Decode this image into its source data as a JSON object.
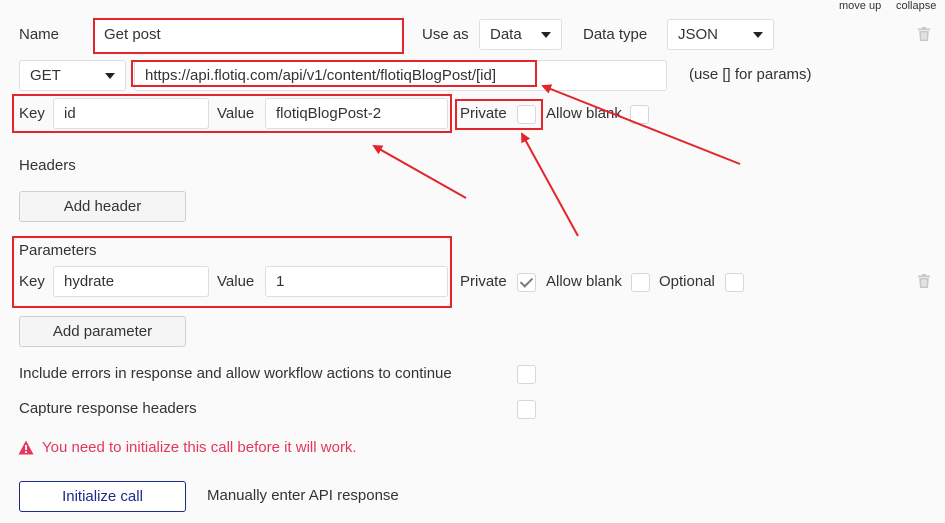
{
  "top_links": {
    "move_up": "move up",
    "collapse": "collapse"
  },
  "row1": {
    "name_label": "Name",
    "name_value": "Get post",
    "use_as_label": "Use as",
    "use_as_value": "Data",
    "data_type_label": "Data type",
    "data_type_value": "JSON"
  },
  "row2": {
    "method": "GET",
    "url": "https://api.flotiq.com/api/v1/content/flotiqBlogPost/[id]",
    "hint": "(use [] for params)"
  },
  "url_param": {
    "key_label": "Key",
    "key_value": "id",
    "value_label": "Value",
    "value_value": "flotiqBlogPost-2",
    "private_label": "Private",
    "private_checked": false,
    "allow_blank_label": "Allow blank",
    "allow_blank_checked": false
  },
  "headers": {
    "title": "Headers",
    "add_button": "Add header"
  },
  "parameters": {
    "title": "Parameters",
    "key_label": "Key",
    "key_value": "hydrate",
    "value_label": "Value",
    "value_value": "1",
    "private_label": "Private",
    "private_checked": true,
    "allow_blank_label": "Allow blank",
    "allow_blank_checked": false,
    "optional_label": "Optional",
    "optional_checked": false,
    "add_button": "Add parameter"
  },
  "options": {
    "include_errors_label": "Include errors in response and allow workflow actions to continue",
    "capture_headers_label": "Capture response headers"
  },
  "warning": {
    "icon": "warning-triangle-icon",
    "text": "You need to initialize this call before it will work.",
    "color": "#e5365f"
  },
  "footer": {
    "initialize_button": "Initialize call",
    "manual_link": "Manually enter API response"
  },
  "colors": {
    "annotation_red": "#e3262b",
    "primary_blue": "#1e2a8c"
  }
}
